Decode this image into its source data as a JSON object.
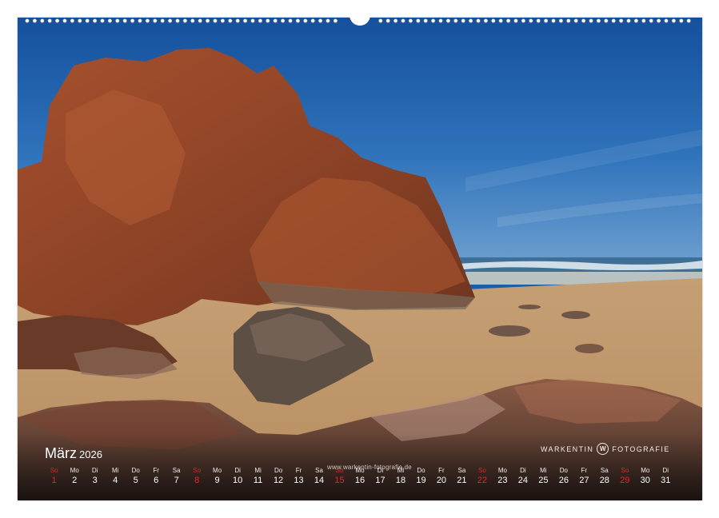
{
  "calendar": {
    "month": "März",
    "year": "2026",
    "watermark": "www.warkentin-fotografie.de",
    "brand": {
      "left": "WARKENTIN",
      "logo": "W",
      "right": "FOTOGRAFIE"
    },
    "days": [
      {
        "wd": "So",
        "dn": "1",
        "sun": true
      },
      {
        "wd": "Mo",
        "dn": "2"
      },
      {
        "wd": "Di",
        "dn": "3"
      },
      {
        "wd": "Mi",
        "dn": "4"
      },
      {
        "wd": "Do",
        "dn": "5"
      },
      {
        "wd": "Fr",
        "dn": "6"
      },
      {
        "wd": "Sa",
        "dn": "7"
      },
      {
        "wd": "So",
        "dn": "8",
        "sun": true
      },
      {
        "wd": "Mo",
        "dn": "9"
      },
      {
        "wd": "Di",
        "dn": "10"
      },
      {
        "wd": "Mi",
        "dn": "11"
      },
      {
        "wd": "Do",
        "dn": "12"
      },
      {
        "wd": "Fr",
        "dn": "13"
      },
      {
        "wd": "Sa",
        "dn": "14"
      },
      {
        "wd": "So",
        "dn": "15",
        "sun": true
      },
      {
        "wd": "Mo",
        "dn": "16"
      },
      {
        "wd": "Di",
        "dn": "17"
      },
      {
        "wd": "Mi",
        "dn": "18"
      },
      {
        "wd": "Do",
        "dn": "19"
      },
      {
        "wd": "Fr",
        "dn": "20"
      },
      {
        "wd": "Sa",
        "dn": "21"
      },
      {
        "wd": "So",
        "dn": "22",
        "sun": true
      },
      {
        "wd": "Mo",
        "dn": "23"
      },
      {
        "wd": "Di",
        "dn": "24"
      },
      {
        "wd": "Mi",
        "dn": "25"
      },
      {
        "wd": "Do",
        "dn": "26"
      },
      {
        "wd": "Fr",
        "dn": "27"
      },
      {
        "wd": "Sa",
        "dn": "28"
      },
      {
        "wd": "So",
        "dn": "29",
        "sun": true
      },
      {
        "wd": "Mo",
        "dn": "30"
      },
      {
        "wd": "Di",
        "dn": "31"
      }
    ]
  },
  "colors": {
    "sunday": "#e8262c",
    "sky": "#1c5ea8",
    "sand": "#c79a6a",
    "rock": "#9a4a2c"
  }
}
